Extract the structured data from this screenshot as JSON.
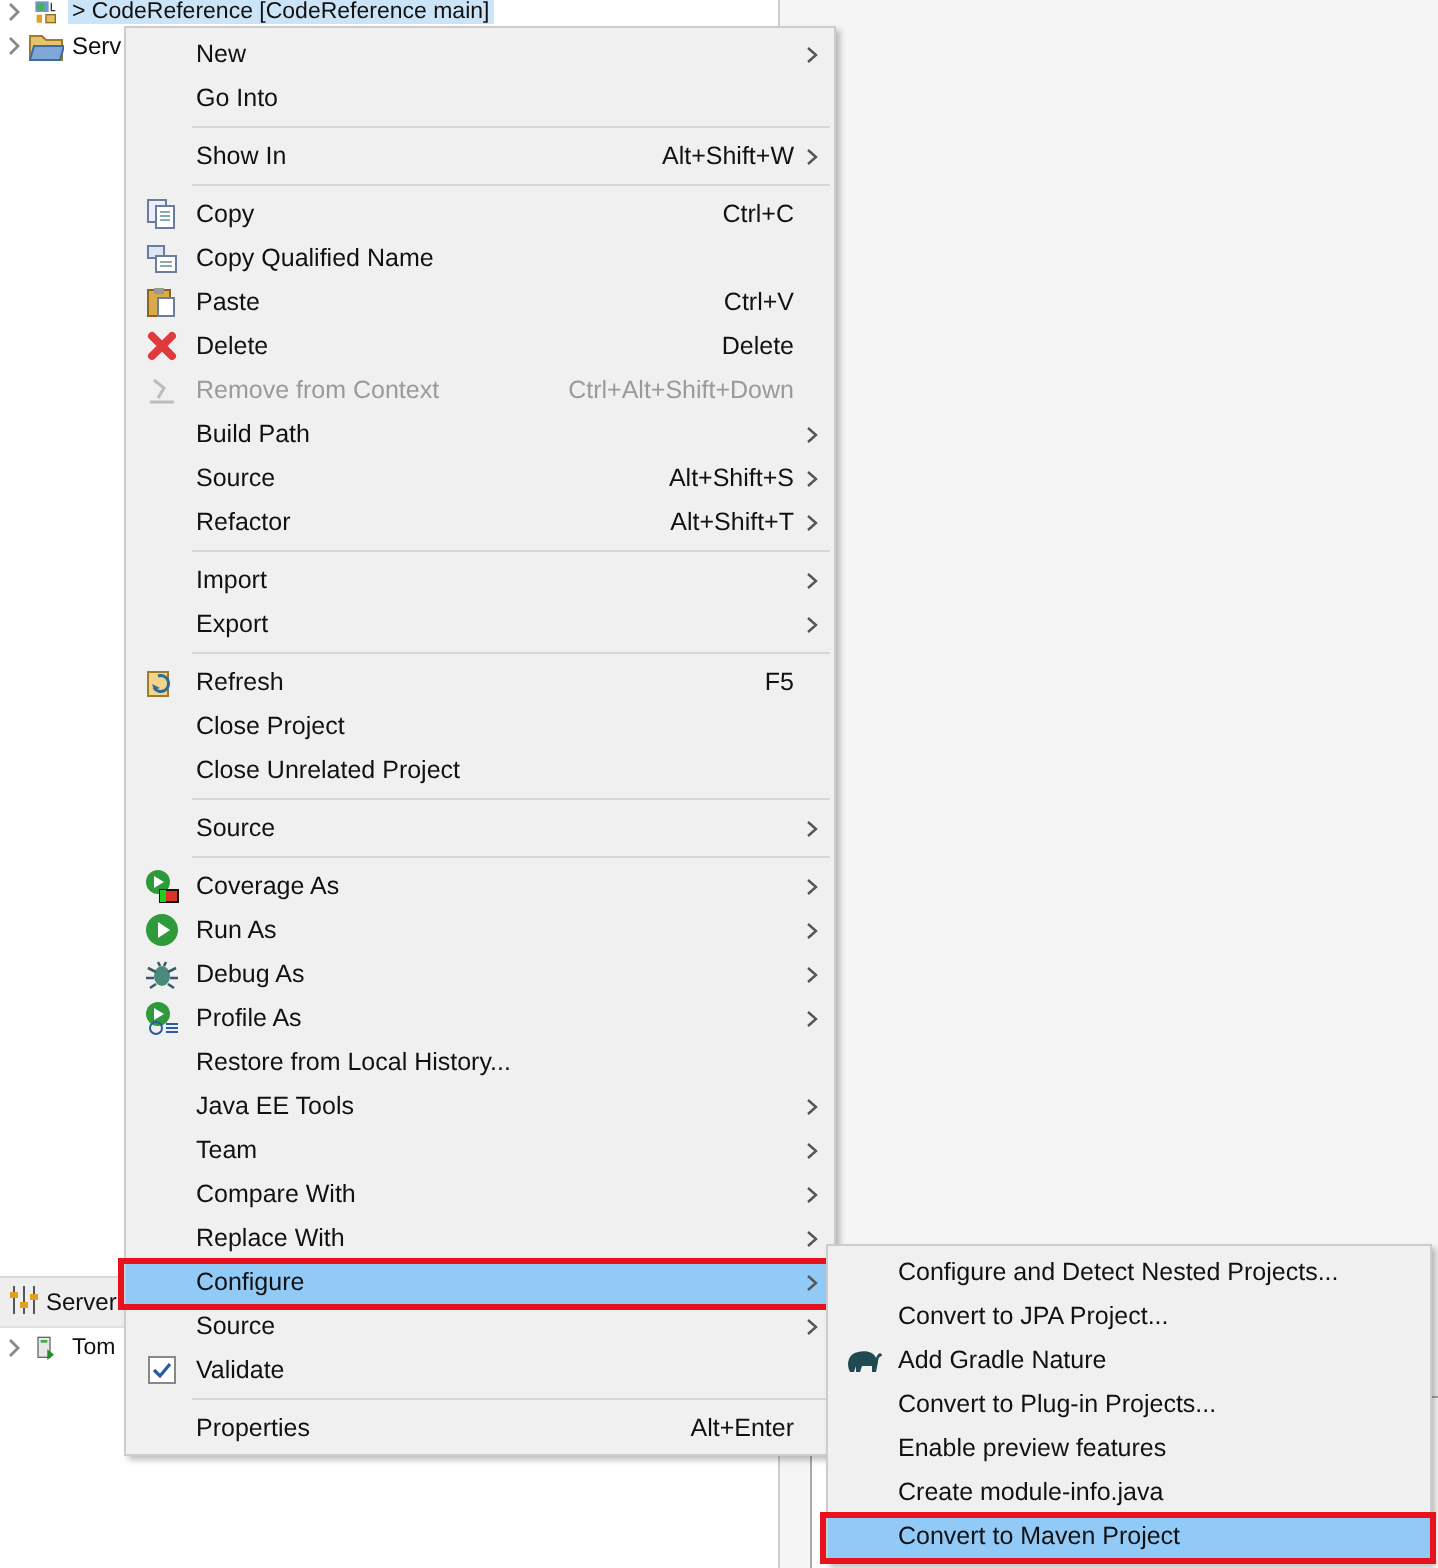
{
  "tree": {
    "items": [
      {
        "kind": "project",
        "prefix": ">",
        "label": "CodeReference [CodeReference main]",
        "selected": true
      },
      {
        "kind": "folder",
        "label": "Serv",
        "selected": false
      }
    ]
  },
  "servers_panel": {
    "tab": "Server",
    "items": [
      {
        "kind": "server",
        "label": "Tom"
      }
    ]
  },
  "context_menu": {
    "items": [
      {
        "kind": "plain",
        "label": "New",
        "submenu": true
      },
      {
        "kind": "plain",
        "label": "Go Into",
        "submenu": false
      },
      {
        "kind": "separator"
      },
      {
        "kind": "plain",
        "label": "Show In",
        "shortcut": "Alt+Shift+W",
        "submenu": true
      },
      {
        "kind": "separator"
      },
      {
        "kind": "copy",
        "label": "Copy",
        "shortcut": "Ctrl+C",
        "submenu": false
      },
      {
        "kind": "copy-qualified",
        "label": "Copy Qualified Name",
        "submenu": false
      },
      {
        "kind": "paste",
        "label": "Paste",
        "shortcut": "Ctrl+V",
        "submenu": false
      },
      {
        "kind": "delete",
        "label": "Delete",
        "shortcut": "Delete",
        "submenu": false
      },
      {
        "kind": "remove",
        "label": "Remove from Context",
        "shortcut": "Ctrl+Alt+Shift+Down",
        "disabled": true,
        "submenu": false
      },
      {
        "kind": "plain",
        "label": "Build Path",
        "submenu": true
      },
      {
        "kind": "plain",
        "label": "Source",
        "shortcut": "Alt+Shift+S",
        "submenu": true
      },
      {
        "kind": "plain",
        "label": "Refactor",
        "shortcut": "Alt+Shift+T",
        "submenu": true
      },
      {
        "kind": "separator"
      },
      {
        "kind": "plain",
        "label": "Import",
        "submenu": true
      },
      {
        "kind": "plain",
        "label": "Export",
        "submenu": true
      },
      {
        "kind": "separator"
      },
      {
        "kind": "refresh",
        "label": "Refresh",
        "shortcut": "F5",
        "submenu": false
      },
      {
        "kind": "plain",
        "label": "Close Project",
        "submenu": false
      },
      {
        "kind": "plain",
        "label": "Close Unrelated Project",
        "submenu": false
      },
      {
        "kind": "separator"
      },
      {
        "kind": "plain",
        "label": "Source",
        "submenu": true
      },
      {
        "kind": "separator"
      },
      {
        "kind": "coverage",
        "label": "Coverage As",
        "submenu": true
      },
      {
        "kind": "run",
        "label": "Run As",
        "submenu": true
      },
      {
        "kind": "debug",
        "label": "Debug As",
        "submenu": true
      },
      {
        "kind": "profile",
        "label": "Profile As",
        "submenu": true
      },
      {
        "kind": "plain",
        "label": "Restore from Local History...",
        "submenu": false
      },
      {
        "kind": "plain",
        "label": "Java EE Tools",
        "submenu": true
      },
      {
        "kind": "plain",
        "label": "Team",
        "submenu": true
      },
      {
        "kind": "plain",
        "label": "Compare With",
        "submenu": true
      },
      {
        "kind": "plain",
        "label": "Replace With",
        "submenu": true
      },
      {
        "kind": "plain",
        "label": "Configure",
        "submenu": true,
        "selected": true,
        "outlined": true
      },
      {
        "kind": "plain",
        "label": "Source",
        "submenu": true
      },
      {
        "kind": "check",
        "label": "Validate",
        "submenu": false
      },
      {
        "kind": "separator"
      },
      {
        "kind": "plain",
        "label": "Properties",
        "shortcut": "Alt+Enter",
        "submenu": false
      }
    ]
  },
  "submenu": {
    "items": [
      {
        "kind": "plain",
        "label": "Configure and Detect Nested Projects..."
      },
      {
        "kind": "plain",
        "label": "Convert to JPA Project..."
      },
      {
        "kind": "elephant",
        "label": "Add Gradle Nature"
      },
      {
        "kind": "plain",
        "label": "Convert to Plug-in Projects..."
      },
      {
        "kind": "plain",
        "label": "Enable preview features"
      },
      {
        "kind": "plain",
        "label": "Create module-info.java"
      },
      {
        "kind": "plain",
        "label": "Convert to Maven Project",
        "selected": true,
        "outlined": true
      }
    ]
  }
}
